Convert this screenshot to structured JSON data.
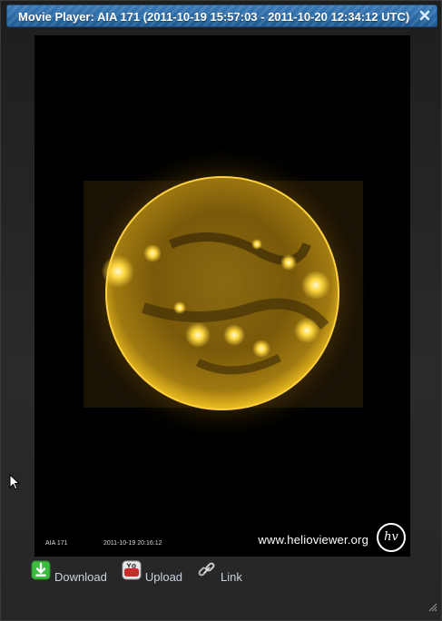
{
  "dialog": {
    "title": "Movie Player: AIA 171 (2011-10-19 15:57:03 - 2011-10-20 12:34:12 UTC)",
    "close_icon": "close-icon",
    "title_color": "#2a6aa6"
  },
  "video": {
    "layer_label": "AIA 171",
    "frame_timestamp": "2011-10-19 20:16:12",
    "watermark_url": "www.helioviewer.org",
    "logo_text": "hv"
  },
  "actions": [
    {
      "label": "Download",
      "icon": "download-icon"
    },
    {
      "label": "Upload",
      "icon": "youtube-icon"
    },
    {
      "label": "Link",
      "icon": "link-icon"
    }
  ],
  "colors": {
    "accent": "#2a6aa6",
    "download_green": "#3cbc3c",
    "youtube_red": "#cc2a2a",
    "sun_gold": "#c89a10"
  }
}
